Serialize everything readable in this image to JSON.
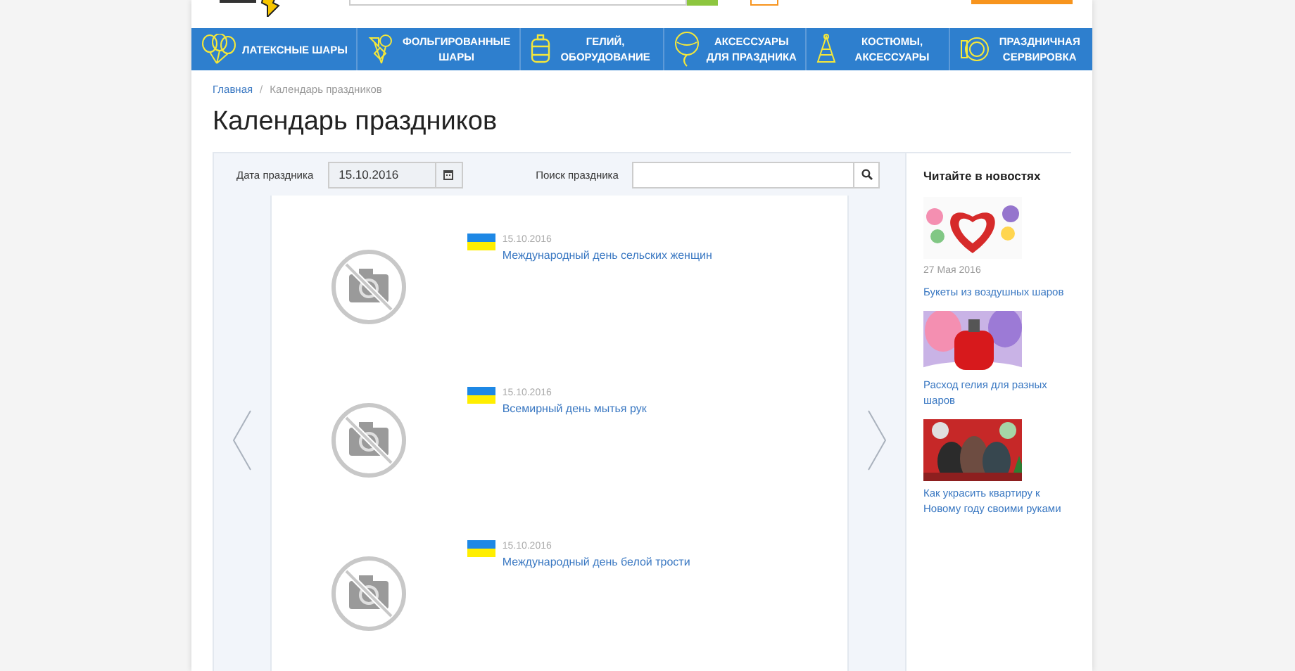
{
  "nav": [
    {
      "label": "ЛАТЕКСНЫЕ ШАРЫ",
      "kind": "balloons"
    },
    {
      "label": "ФОЛЬГИРОВАННЫЕ ШАРЫ",
      "kind": "foil"
    },
    {
      "label": "ГЕЛИЙ, ОБОРУДОВАНИЕ",
      "kind": "helium"
    },
    {
      "label": "АКСЕССУАРЫ ДЛЯ ПРАЗДНИКА",
      "kind": "accessory"
    },
    {
      "label": "КОСТЮМЫ, АКСЕССУАРЫ",
      "kind": "costume"
    },
    {
      "label": "ПРАЗДНИЧНАЯ СЕРВИРОВКА",
      "kind": "tableware"
    }
  ],
  "breadcrumb": [
    "Главная",
    "Календарь праздников"
  ],
  "breadcrumb_separator": "/",
  "title": "Календарь праздников",
  "filters": {
    "date_label": "Дата праздника",
    "date_value": "15.10.2016",
    "search_label": "Поиск праздника"
  },
  "events": [
    {
      "date": "15.10.2016",
      "name": "Международный день сельских женщин"
    },
    {
      "date": "15.10.2016",
      "name": "Всемирный день мытья рук"
    },
    {
      "date": "15.10.2016",
      "name": "Международный день белой трости"
    }
  ],
  "news": {
    "heading": "Читайте в новостях",
    "items": [
      {
        "date": "27 Мая 2016",
        "title": "Букеты из воздушных шаров",
        "kind": "picture"
      },
      {
        "title": "Расход гелия для разных шаров",
        "kind": "picture"
      },
      {
        "title": "Как украсить квартиру к Новому году своими руками",
        "kind": "picture"
      }
    ]
  }
}
